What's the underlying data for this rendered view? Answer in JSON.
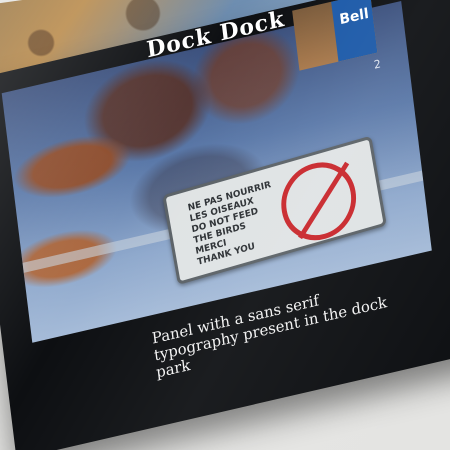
{
  "magazine": {
    "title": "Dock Dock",
    "caption": "Panel with a sans serif typography present in the dock park",
    "sign": {
      "lines": [
        "NE PAS NOURRIR",
        "LES OISEAUX",
        "DO NOT FEED",
        "THE BIRDS",
        "MERCI",
        "THANK YOU"
      ]
    },
    "side_logo": "Bell",
    "side_number": "2"
  },
  "colors": {
    "page": "#0d0f12",
    "sign_background": "#dfe3e4",
    "no_symbol": "#c8252a",
    "logo_blue": "#1b59a8"
  }
}
